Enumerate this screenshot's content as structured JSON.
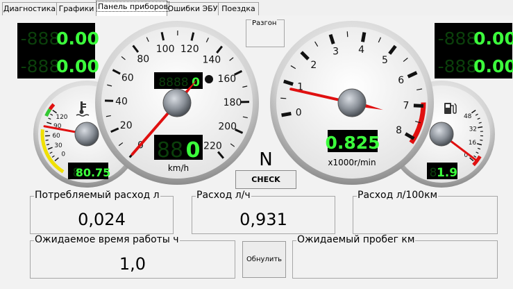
{
  "tabs": [
    {
      "label": "Диагностика",
      "active": false
    },
    {
      "label": "Графики",
      "active": false
    },
    {
      "label": "Панель приборов",
      "active": true
    },
    {
      "label": "Ошибки ЭБУ",
      "active": false
    },
    {
      "label": "Поездка",
      "active": false
    }
  ],
  "lcd": {
    "left_top_ghost": "-888",
    "left_top_value": "0.00",
    "left_bottom_ghost": "-888",
    "left_bottom_value": "0.00",
    "right_top_ghost": "-888",
    "right_top_value": "0.00",
    "right_bottom_ghost": "-888",
    "right_bottom_value": "0.00"
  },
  "temp_gauge": {
    "ticks": [
      "120",
      "90",
      "60",
      "30",
      "0"
    ],
    "display_ghost": "8",
    "display_value": "80.75",
    "icon": "coolant-temperature-icon"
  },
  "speedometer": {
    "ticks": [
      "0",
      "20",
      "40",
      "60",
      "80",
      "100",
      "120",
      "140",
      "160",
      "180",
      "200",
      "220"
    ],
    "speed": 0,
    "odometer_ghost": "8888",
    "odometer_value": "0",
    "display_ghost": "88",
    "display_value": "0",
    "unit": "km/h"
  },
  "tachometer": {
    "ticks": [
      "0",
      "1",
      "2",
      "3",
      "4",
      "5",
      "6",
      "7",
      "8"
    ],
    "rpm_thousands": 0.825,
    "display_value": "0.825",
    "unit": "x1000r/min"
  },
  "fuel_gauge": {
    "ticks": [
      "48",
      "32",
      "16",
      "0"
    ],
    "display_ghost": "8",
    "display_value": "1.9",
    "icon": "fuel-pump-icon"
  },
  "gear": "N",
  "check_label": "CHECK",
  "razgon_label": "Разгон",
  "stats": {
    "consumed_label": "Потребляемый расход л",
    "consumed_value": "0,024",
    "per_hour_label": "Расход л/ч",
    "per_hour_value": "0,931",
    "per_100km_label": "Расход л/100км",
    "per_100km_value": "",
    "runtime_label": "Ожидаемое время работы ч",
    "runtime_value": "1,0",
    "range_label": "Ожидаемый пробег км",
    "range_value": ""
  },
  "reset_button": "Обнулить",
  "colors": {
    "lcd_on": "#3cff3c",
    "lcd_off": "#0b3f0b",
    "needle": "#e01010",
    "redzone": "#e01010",
    "greenzone": "#32c832",
    "yellowzone": "#f0e000"
  }
}
